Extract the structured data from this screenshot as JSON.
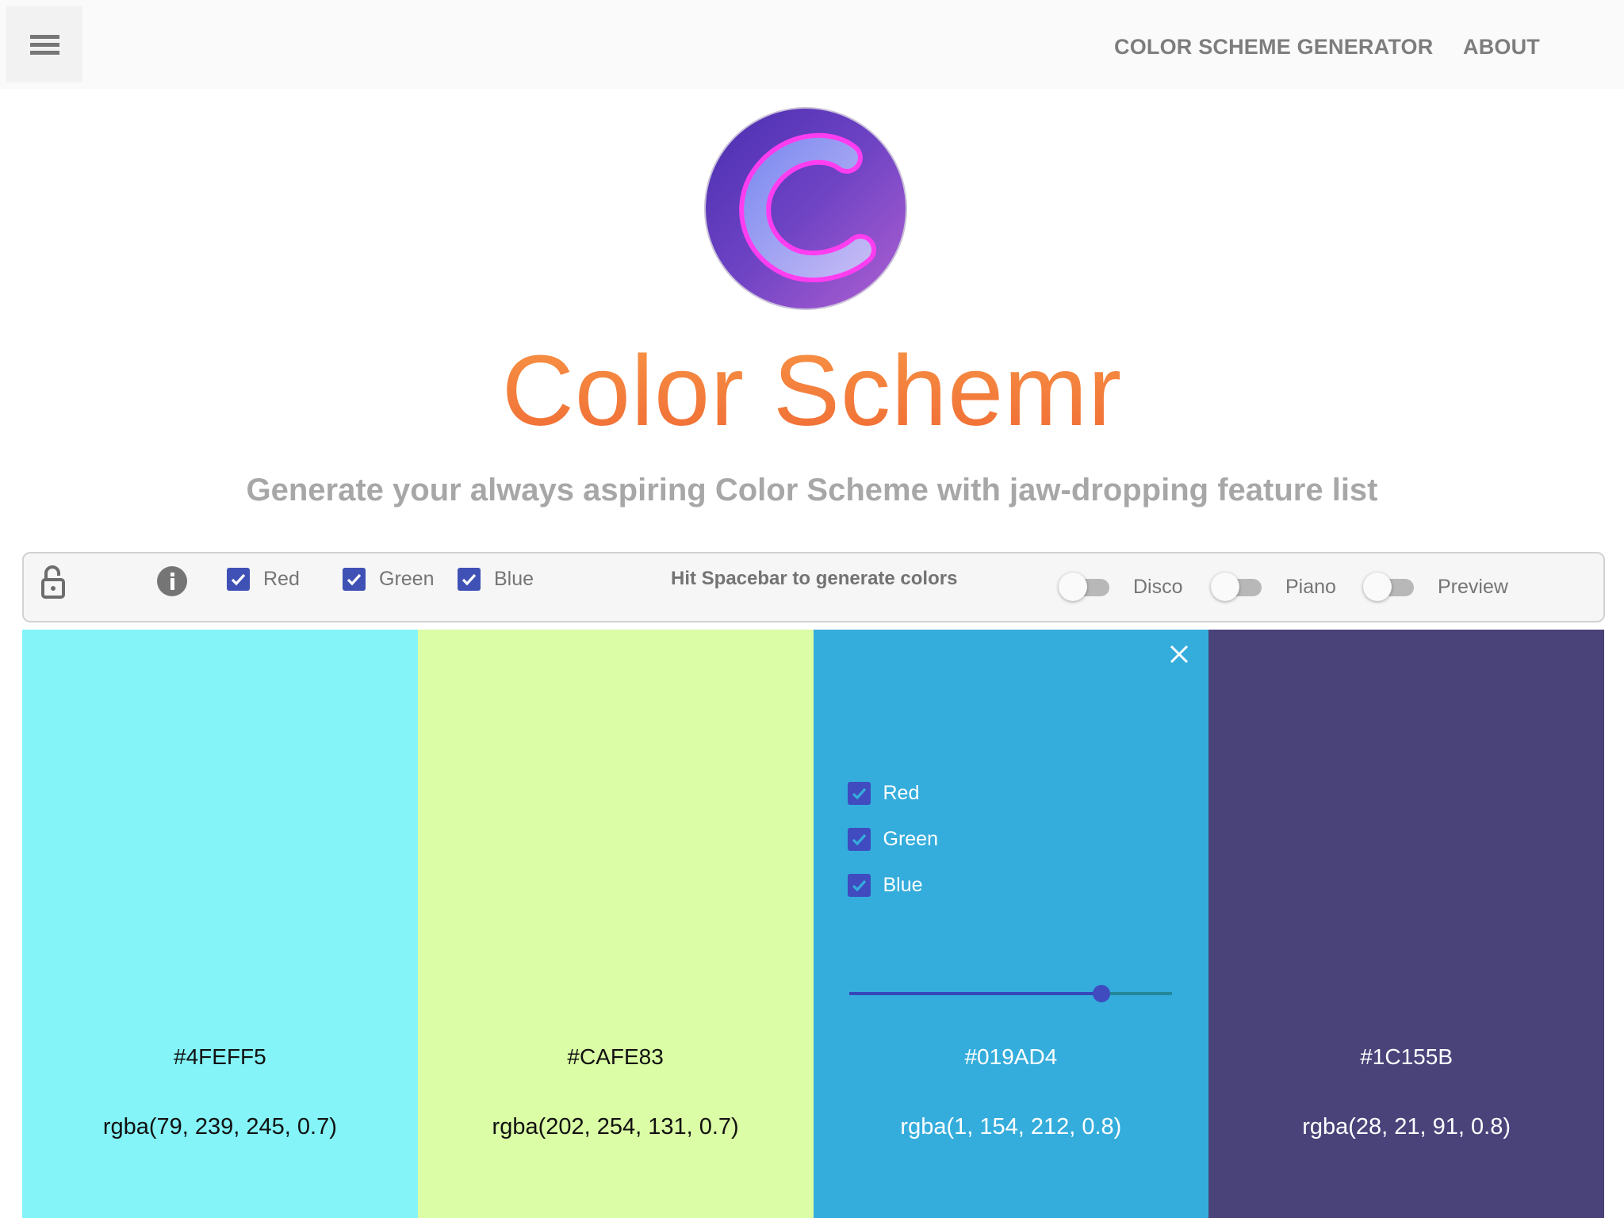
{
  "appbar": {
    "menu_icon": "hamburger-menu-icon",
    "nav": [
      {
        "label": "COLOR SCHEME GENERATOR"
      },
      {
        "label": "ABOUT"
      }
    ]
  },
  "hero": {
    "logo_icon": "color-schemr-logo-c",
    "title": "Color Schemr",
    "subtitle": "Generate your always aspiring Color Scheme with jaw-dropping feature list",
    "title_colors": [
      "#F79545",
      "#F06A35"
    ]
  },
  "toolbar": {
    "lock_icon": "unlock-icon",
    "info_icon": "info-icon",
    "channels": [
      {
        "label": "Red",
        "checked": true
      },
      {
        "label": "Green",
        "checked": true
      },
      {
        "label": "Blue",
        "checked": true
      }
    ],
    "hint": "Hit Spacebar to generate colors",
    "toggles": [
      {
        "label": "Disco",
        "on": false
      },
      {
        "label": "Piano",
        "on": false
      },
      {
        "label": "Preview",
        "on": false
      }
    ],
    "accent_color": "#3F51B5"
  },
  "swatches": [
    {
      "hex": "#4FEFF5",
      "rgba": "rgba(79, 239, 245, 0.7)",
      "display_color": "#84F4F8",
      "text_color": "dark"
    },
    {
      "hex": "#CAFE83",
      "rgba": "rgba(202, 254, 131, 0.7)",
      "display_color": "#DAFDA5",
      "text_color": "dark"
    },
    {
      "hex": "#019AD4",
      "rgba": "rgba(1, 154, 212, 0.8)",
      "display_color": "#34ADDC",
      "text_color": "light",
      "editing": true,
      "close_icon": "close-icon",
      "channels": [
        {
          "label": "Red",
          "checked": true
        },
        {
          "label": "Green",
          "checked": true
        },
        {
          "label": "Blue",
          "checked": true
        }
      ],
      "slider_value": 0.78
    },
    {
      "hex": "#1C155B",
      "rgba": "rgba(28, 21, 91, 0.8)",
      "display_color": "#49437A",
      "text_color": "light"
    }
  ]
}
